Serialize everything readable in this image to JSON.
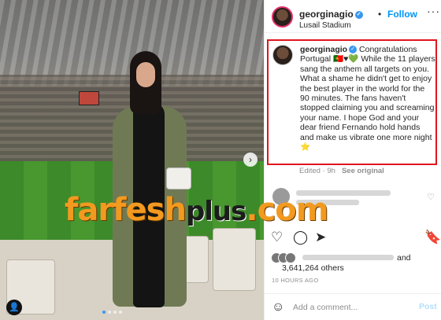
{
  "post": {
    "username": "georginagio",
    "follow_label": "Follow",
    "separator": "•",
    "location": "Lusail Stadium",
    "more_icon": "ellipsis-icon"
  },
  "caption": {
    "username": "georginagio",
    "text": "Congratulations Portugal 🇵🇹♥💚 While the 11 players sang the anthem all targets on you. What a shame he didn't get to enjoy the best player in the world for the 90 minutes. The fans haven't stopped claiming you and screaming your name. I hope God and your dear friend Fernando hold hands and make us vibrate one more night ⭐",
    "meta_time": "Edited · 9h",
    "see_original": "See original"
  },
  "watermark": {
    "main": "farfesh",
    "plus": "plus",
    "suffix": ".com"
  },
  "likes": {
    "and_label": "and",
    "count_text": "3,641,264 others"
  },
  "timestamp": "10 HOURS AGO",
  "add_comment": {
    "placeholder": "Add a comment...",
    "post_label": "Post"
  },
  "photo": {
    "next_arrow": "›",
    "tag_icon": "user-tag-icon"
  },
  "colors": {
    "accent": "#0095f6",
    "highlight_box": "#e0151e",
    "watermark": "#f29a1f"
  }
}
